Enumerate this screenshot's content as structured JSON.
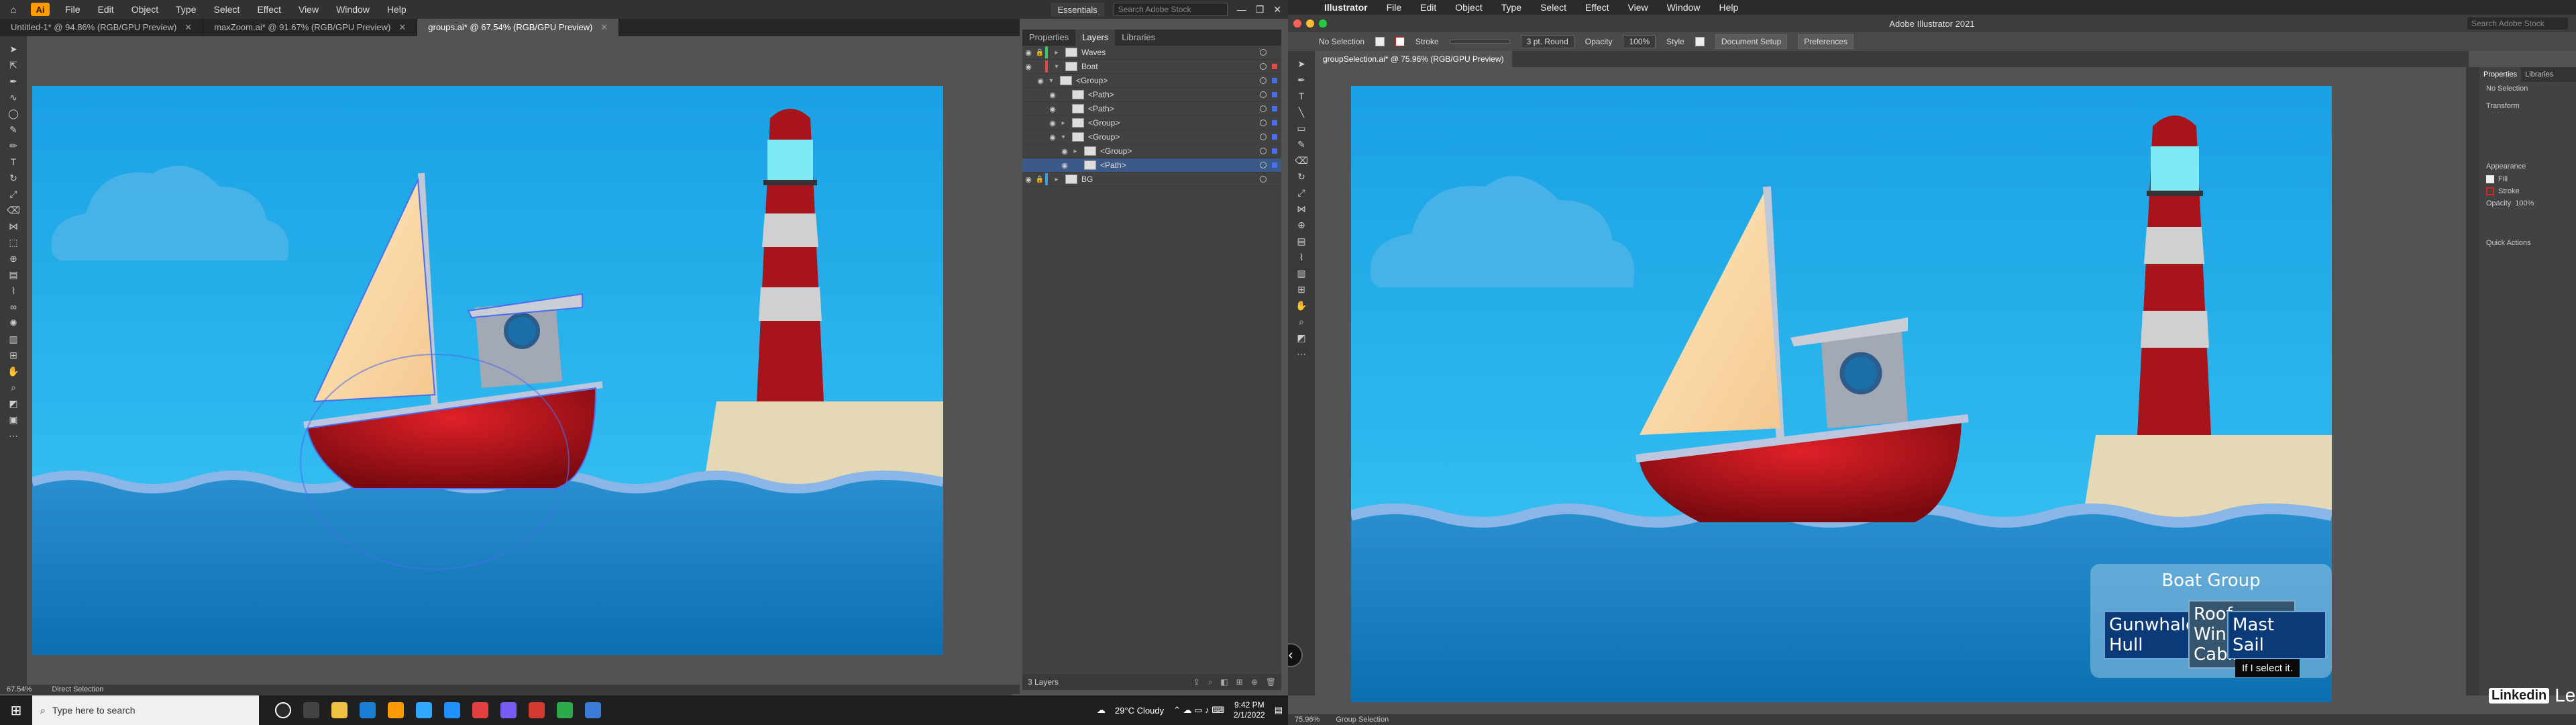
{
  "left": {
    "menubar": {
      "app_badge": "Ai",
      "items": [
        "File",
        "Edit",
        "Object",
        "Type",
        "Select",
        "Effect",
        "View",
        "Window",
        "Help"
      ],
      "workspace": "Essentials",
      "search_placeholder": "Search Adobe Stock"
    },
    "tabs": [
      {
        "label": "Untitled-1* @ 94.86% (RGB/GPU Preview)"
      },
      {
        "label": "maxZoom.ai* @ 91.67% (RGB/GPU Preview)"
      },
      {
        "label": "groups.ai* @ 67.54% (RGB/GPU Preview)"
      }
    ],
    "panel_tabs": [
      "Properties",
      "Layers",
      "Libraries"
    ],
    "layers": [
      {
        "name": "Waves"
      },
      {
        "name": "Boat"
      },
      {
        "name": "<Group>"
      },
      {
        "name": "<Path>"
      },
      {
        "name": "<Path>"
      },
      {
        "name": "<Group>"
      },
      {
        "name": "<Group>"
      },
      {
        "name": "<Group>"
      },
      {
        "name": "<Path>"
      },
      {
        "name": "BG"
      }
    ],
    "layers_count": "3 Layers",
    "status": {
      "zoom": "67.54%",
      "tool": "Direct Selection"
    },
    "taskbar": {
      "search_placeholder": "Type here to search",
      "weather": "29°C  Cloudy",
      "time": "9:42 PM",
      "date": "2/1/2022"
    }
  },
  "right": {
    "menubar": {
      "app_name": "Illustrator",
      "items": [
        "File",
        "Edit",
        "Object",
        "Type",
        "Select",
        "Effect",
        "View",
        "Window",
        "Help"
      ]
    },
    "window_title": "Adobe Illustrator 2021",
    "search_placeholder": "Search Adobe Stock",
    "control_bar": {
      "selection": "No Selection",
      "stroke_label": "Stroke",
      "brush": "3 pt. Round",
      "opacity_label": "Opacity",
      "opacity_value": "100%",
      "style_label": "Style",
      "doc_setup": "Document Setup",
      "preferences": "Preferences"
    },
    "doc_tab": "groupSelection.ai* @ 75.96% (RGB/GPU Preview)",
    "props_panel": {
      "tabs": [
        "Properties",
        "Libraries"
      ],
      "selection": "No Selection",
      "transform": "Transform",
      "appearance": "Appearance",
      "fill": "Fill",
      "stroke": "Stroke",
      "opacity_label": "Opacity",
      "opacity_value": "100%",
      "quick_actions": "Quick Actions"
    },
    "overlay": {
      "title": "Boat Group",
      "left_box": [
        "Gunwhale",
        "Hull"
      ],
      "mid_box": [
        "Roof",
        "Window",
        "Cabin"
      ],
      "right_box": [
        "Mast",
        "Sail"
      ],
      "tooltip": "If I select it."
    },
    "status": {
      "zoom": "75.96%",
      "tool": "Group Selection"
    },
    "watermark": "Learning"
  },
  "colors": {
    "sky": "#1fa6e8",
    "hull": "#b0141c",
    "sea": "#1a7fbf",
    "selection": "#4a6ef0"
  }
}
